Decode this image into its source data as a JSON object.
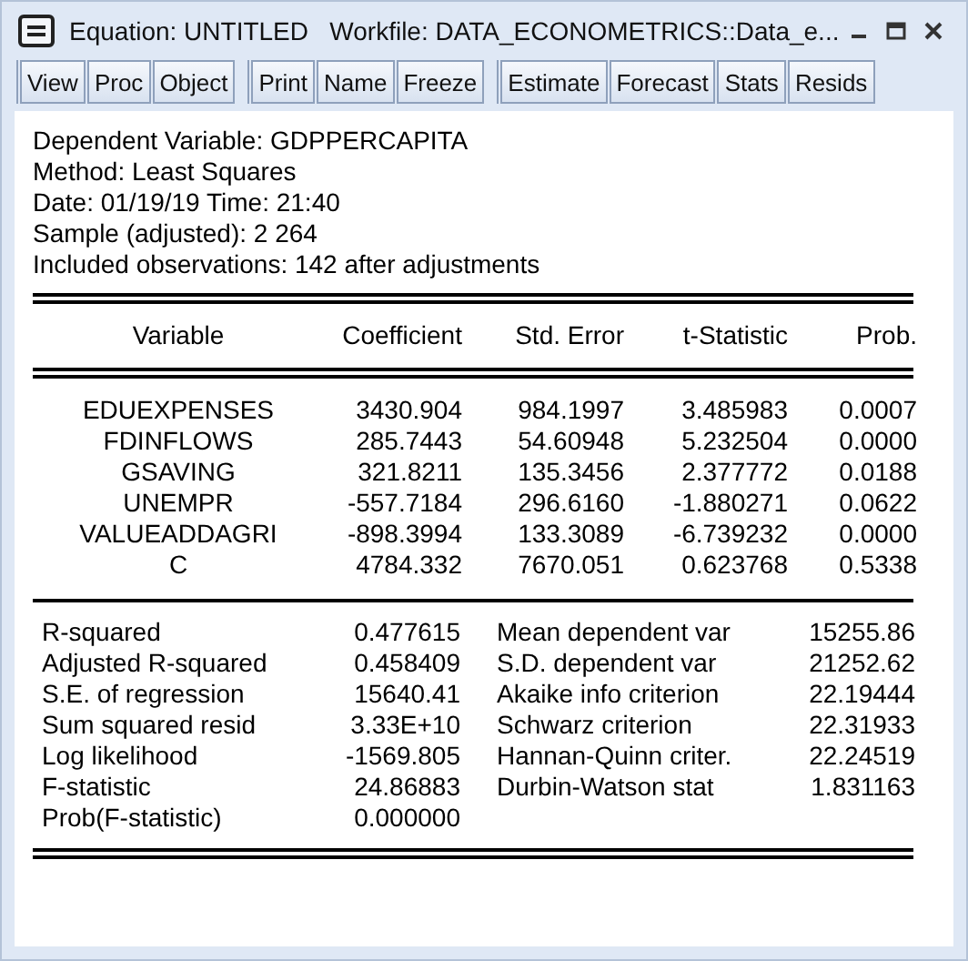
{
  "window": {
    "title": "Equation: UNTITLED   Workfile: DATA_ECONOMETRICS::Data_e..."
  },
  "toolbar": [
    [
      "View",
      "Proc",
      "Object"
    ],
    [
      "Print",
      "Name",
      "Freeze"
    ],
    [
      "Estimate",
      "Forecast",
      "Stats",
      "Resids"
    ]
  ],
  "header": [
    "Dependent Variable: GDPPERCAPITA",
    "Method: Least Squares",
    "Date: 01/19/19   Time: 21:40",
    "Sample (adjusted): 2 264",
    "Included observations: 142 after adjustments"
  ],
  "table": {
    "columns": [
      "Variable",
      "Coefficient",
      "Std. Error",
      "t-Statistic",
      "Prob."
    ],
    "rows": [
      [
        "EDUEXPENSES",
        "3430.904",
        "984.1997",
        "3.485983",
        "0.0007"
      ],
      [
        "FDINFLOWS",
        "285.7443",
        "54.60948",
        "5.232504",
        "0.0000"
      ],
      [
        "GSAVING",
        "321.8211",
        "135.3456",
        "2.377772",
        "0.0188"
      ],
      [
        "UNEMPR",
        "-557.7184",
        "296.6160",
        "-1.880271",
        "0.0622"
      ],
      [
        "VALUEADDAGRI",
        "-898.3994",
        "133.3089",
        "-6.739232",
        "0.0000"
      ],
      [
        "C",
        "4784.332",
        "7670.051",
        "0.623768",
        "0.5338"
      ]
    ]
  },
  "statistics": [
    [
      "R-squared",
      "0.477615",
      "Mean dependent var",
      "15255.86"
    ],
    [
      "Adjusted R-squared",
      "0.458409",
      "S.D. dependent var",
      "21252.62"
    ],
    [
      "S.E. of regression",
      "15640.41",
      "Akaike info criterion",
      "22.19444"
    ],
    [
      "Sum squared resid",
      "3.33E+10",
      "Schwarz criterion",
      "22.31933"
    ],
    [
      "Log likelihood",
      "-1569.805",
      "Hannan-Quinn criter.",
      "22.24519"
    ],
    [
      "F-statistic",
      "24.86883",
      "Durbin-Watson stat",
      "1.831163"
    ],
    [
      "Prob(F-statistic)",
      "0.000000"
    ]
  ]
}
